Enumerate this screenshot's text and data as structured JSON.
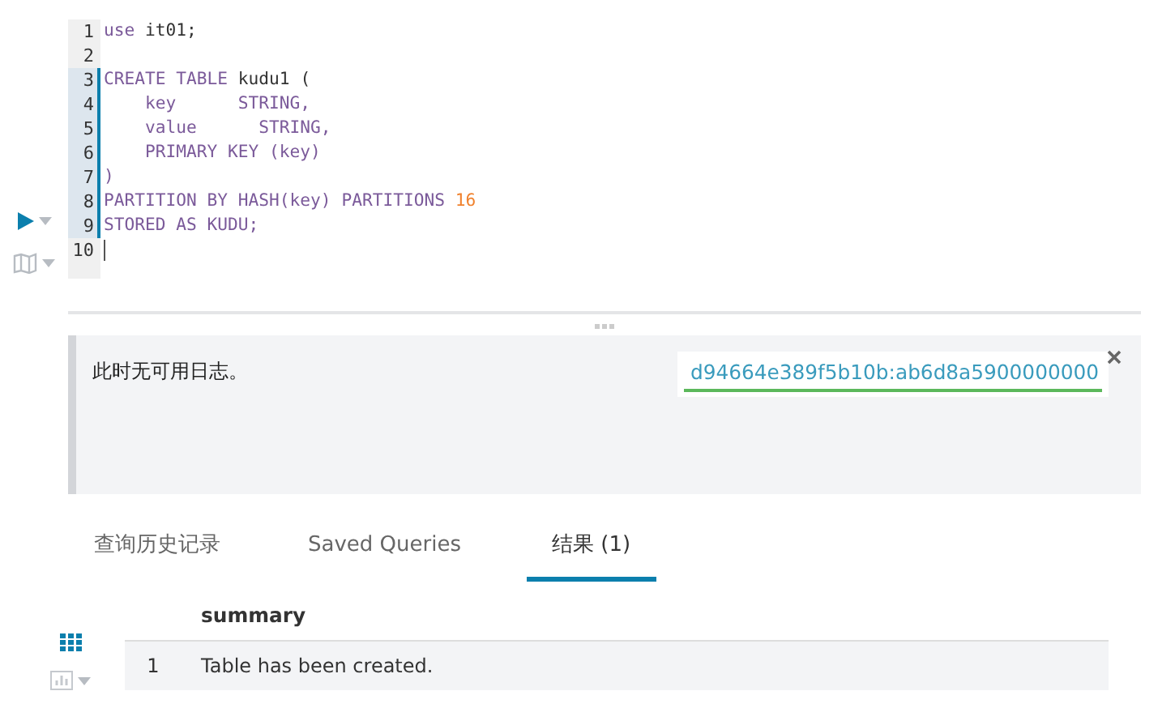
{
  "editor": {
    "lines": [
      {
        "number": "1",
        "highlighted": false,
        "tokens": [
          {
            "text": "use",
            "kind": "keyword"
          },
          {
            "text": " it01;",
            "kind": "plain"
          }
        ]
      },
      {
        "number": "2",
        "highlighted": false
      },
      {
        "number": "3",
        "highlighted": true,
        "tokens": [
          {
            "text": "CREATE TABLE",
            "kind": "keyword"
          },
          {
            "text": " kudu1 (",
            "kind": "plain"
          }
        ]
      },
      {
        "number": "4",
        "highlighted": true,
        "tokens": [
          {
            "text": "    key      STRING,",
            "kind": "keyword"
          }
        ]
      },
      {
        "number": "5",
        "highlighted": true,
        "tokens": [
          {
            "text": "    value      STRING,",
            "kind": "keyword"
          }
        ]
      },
      {
        "number": "6",
        "highlighted": true,
        "tokens": [
          {
            "text": "    PRIMARY KEY (key)",
            "kind": "keyword"
          }
        ]
      },
      {
        "number": "7",
        "highlighted": true,
        "tokens": [
          {
            "text": ")",
            "kind": "keyword"
          }
        ]
      },
      {
        "number": "8",
        "highlighted": true,
        "tokens": [
          {
            "text": "PARTITION BY HASH(key) PARTITIONS",
            "kind": "keyword"
          },
          {
            "text": " 16",
            "kind": "number"
          }
        ]
      },
      {
        "number": "9",
        "highlighted": true,
        "tokens": [
          {
            "text": "STORED AS KUDU;",
            "kind": "keyword"
          }
        ]
      },
      {
        "number": "10",
        "highlighted": false
      }
    ]
  },
  "log": {
    "message": "此时无可用日志。",
    "query_id": "d94664e389f5b10b:ab6d8a5900000000"
  },
  "tabs": [
    {
      "label": "查询历史记录",
      "selected": false
    },
    {
      "label": "Saved Queries",
      "selected": false
    },
    {
      "label": "结果 (1)",
      "selected": true
    }
  ],
  "results": {
    "columns": [
      "summary"
    ],
    "rows": [
      {
        "index": "1",
        "cells": [
          "Table has been created."
        ]
      }
    ]
  }
}
